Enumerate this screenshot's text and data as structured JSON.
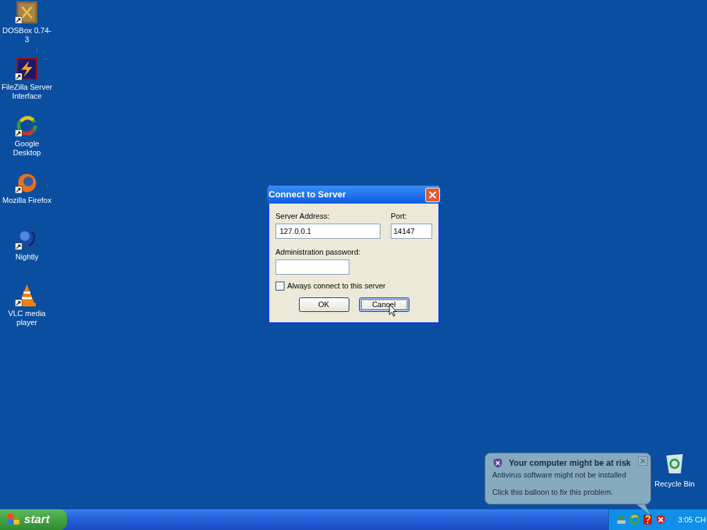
{
  "desktop_icons": [
    {
      "label": "DOSBox 0.74-3",
      "kind": "dosbox"
    },
    {
      "label": "FileZilla Server Interface",
      "kind": "filezilla"
    },
    {
      "label": "Google Desktop",
      "kind": "google"
    },
    {
      "label": "Mozilla Firefox",
      "kind": "firefox"
    },
    {
      "label": "Nightly",
      "kind": "nightly"
    },
    {
      "label": "VLC media player",
      "kind": "vlc"
    }
  ],
  "recycle_bin": {
    "label": "Recycle Bin"
  },
  "dialog": {
    "title": "Connect to Server",
    "server_address": {
      "label": "Server Address:",
      "value": "127.0.0.1"
    },
    "port": {
      "label": "Port:",
      "value": "14147"
    },
    "password": {
      "label": "Administration password:"
    },
    "checkbox": {
      "label": "Always connect to this server",
      "checked": false
    },
    "buttons": [
      {
        "label": "OK",
        "focused": false
      },
      {
        "label": "Cancel",
        "focused": true
      }
    ]
  },
  "balloon": {
    "title": "Your computer might be at risk",
    "lines": [
      "Antivirus software might not be installed",
      "Click this balloon to fix this problem."
    ]
  },
  "taskbar": {
    "start": "start",
    "tray": [
      {
        "kind": "network"
      },
      {
        "kind": "sync"
      },
      {
        "kind": "help"
      },
      {
        "kind": "shield"
      }
    ],
    "clock": "3:05 CH"
  }
}
